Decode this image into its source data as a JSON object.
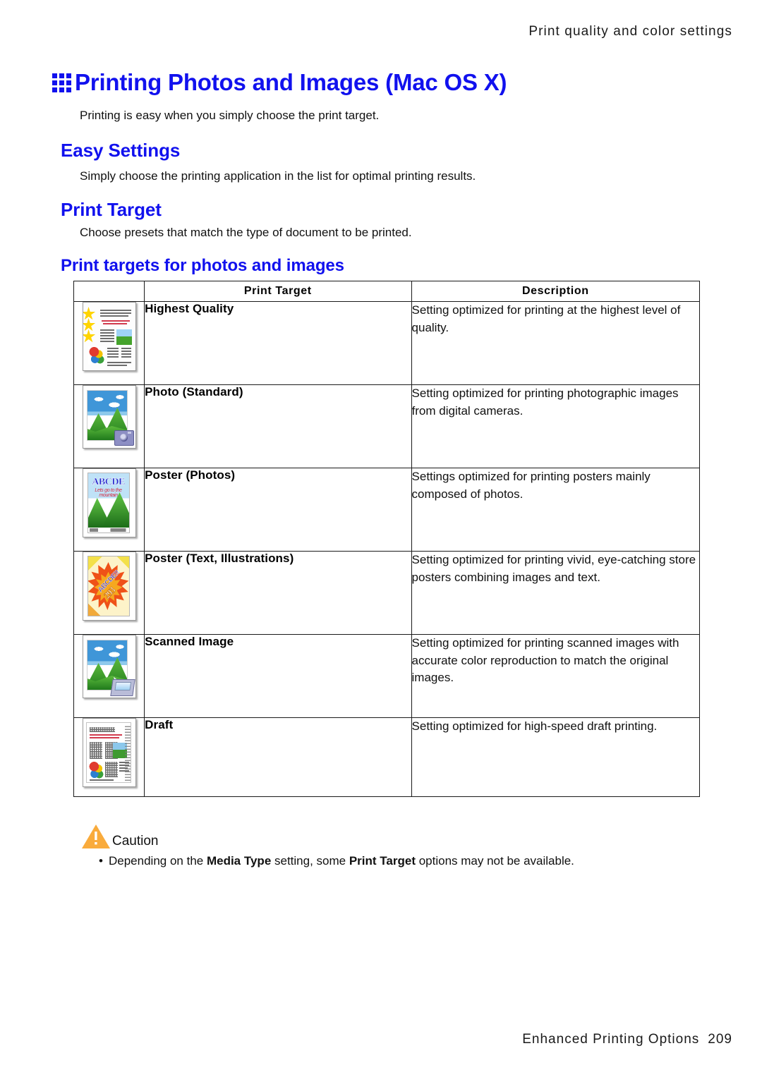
{
  "running_header": "Print quality and color settings",
  "heading": {
    "icon": "grid-3x3-icon",
    "title": "Printing Photos and Images (Mac OS X)",
    "color": "#1111ee"
  },
  "intro_paragraph": "Printing is easy when you simply choose the print target.",
  "sections": [
    {
      "id": "easy-settings",
      "title": "Easy Settings",
      "body": "Simply choose the printing application in the list for optimal printing results."
    },
    {
      "id": "print-target",
      "title": "Print Target",
      "body": "Choose presets that match the type of document to be printed."
    }
  ],
  "subheading": "Print targets for photos and images",
  "table": {
    "headers": [
      "",
      "Print Target",
      "Description"
    ],
    "rows": [
      {
        "thumb": "document-with-stars-thumbnail",
        "name": "Highest Quality",
        "description": "Setting optimized for printing at the highest level of quality."
      },
      {
        "thumb": "photo-with-camera-thumbnail",
        "name": "Photo (Standard)",
        "description": "Setting optimized for printing photographic images from digital cameras."
      },
      {
        "thumb": "poster-photos-thumbnail",
        "name": "Poster (Photos)",
        "description": "Settings optimized for printing posters mainly composed of photos."
      },
      {
        "thumb": "poster-text-illustrations-thumbnail",
        "name": "Poster (Text, Illustrations)",
        "description": "Setting optimized for printing vivid, eye-catching store posters combining images and text."
      },
      {
        "thumb": "photo-with-scanner-thumbnail",
        "name": "Scanned Image",
        "description": "Setting optimized for printing scanned images with accurate color reproduction to match the original images."
      },
      {
        "thumb": "draft-document-thumbnail",
        "name": "Draft",
        "description": "Setting optimized for high-speed draft printing."
      }
    ]
  },
  "thumbnails": {
    "poster_photos": {
      "title": "ABCDE",
      "script": "Lets go to the mountain"
    },
    "poster_text": {
      "title": "ABCDE!!",
      "number": "293"
    }
  },
  "caution": {
    "icon": "warning-triangle-icon",
    "icon_color": "#f9ab3c",
    "label": "Caution",
    "bullet_parts": {
      "p1": "Depending on the ",
      "b1": "Media Type",
      "p2": " setting, some ",
      "b2": "Print Target",
      "p3": " options may not be available."
    }
  },
  "footer": {
    "chapter": "Enhanced Printing Options",
    "page_number": "209"
  }
}
